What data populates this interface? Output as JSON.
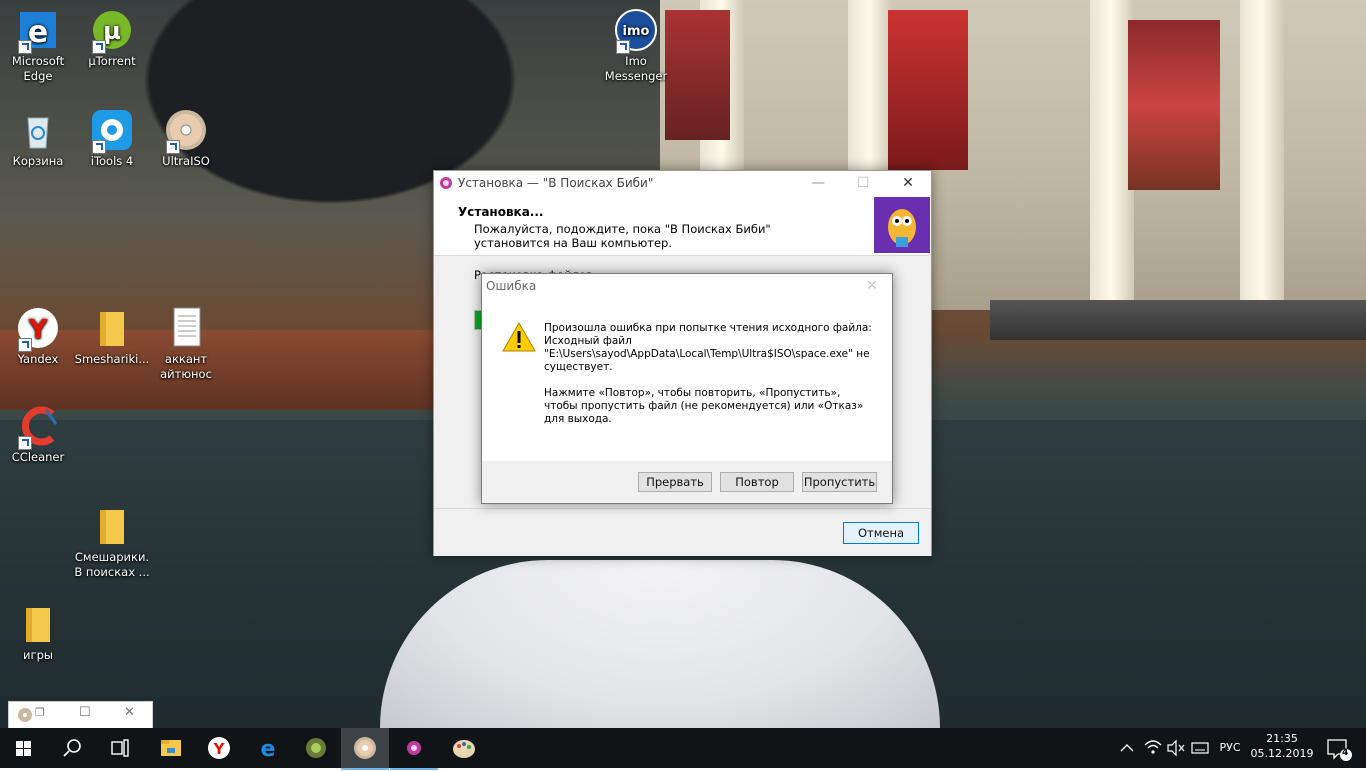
{
  "desktop": {
    "icons": [
      {
        "label": "Microsoft Edge",
        "icon": "edge-icon"
      },
      {
        "label": "µTorrent",
        "icon": "utorrent-icon"
      },
      {
        "label": "Imo Messenger",
        "icon": "imo-icon"
      },
      {
        "label": "Корзина",
        "icon": "recycle-bin-icon"
      },
      {
        "label": "iTools 4",
        "icon": "itools-icon"
      },
      {
        "label": "UltraISO",
        "icon": "ultraiso-icon"
      },
      {
        "label": "Yandex",
        "icon": "yandex-icon"
      },
      {
        "label": "Smeshariki...",
        "icon": "folder-icon"
      },
      {
        "label": "аккант айтюнос",
        "icon": "text-document-icon"
      },
      {
        "label": "CCleaner",
        "icon": "ccleaner-icon"
      },
      {
        "label": "Смешарики. В поисках ...",
        "icon": "folder-icon"
      },
      {
        "label": "игры",
        "icon": "folder-icon"
      }
    ],
    "bg_hint": "photo wallpaper: fountain in front of theatre building"
  },
  "installer": {
    "title": "Установка — \"В Поисках Биби\"",
    "header_title": "Установка...",
    "header_sub": "Пожалуйста, подождите, пока \"В Поисках Биби\" установится на Ваш компьютер.",
    "status_text": "Распаковка файлов...",
    "progress": 0.02,
    "cancel_label": "Отмена"
  },
  "error_dialog": {
    "title": "Ошибка",
    "line1": "Произошла ошибка при попытке чтения исходного файла:",
    "line2": "Исходный файл",
    "line3": "\"E:\\Users\\sayod\\AppData\\Local\\Temp\\Ultra$ISO\\space.exe\" не",
    "line4": "существует.",
    "hint1": "Нажмите «Повтор», чтобы повторить, «Пропустить»,",
    "hint2": "чтобы пропустить файл (не рекомендуется) или «Отказ»",
    "hint3": "для выхода.",
    "abort_label": "Прервать",
    "retry_label": "Повтор",
    "skip_label": "Пропустить"
  },
  "mini_window": {
    "icon": "ultraiso-icon"
  },
  "taskbar": {
    "apps": [
      "start-icon",
      "search-icon",
      "task-view-icon",
      "file-explorer-icon",
      "yandex-icon",
      "edge-icon",
      "itunes-icon",
      "ultraiso-icon",
      "installer-icon",
      "paint-icon"
    ],
    "lang": "РУС",
    "time": "21:35",
    "date": "05.12.2019",
    "notifications": "4"
  },
  "colors": {
    "accent": "#0078d7",
    "warning": "#ffcc00",
    "progress": "#06b025",
    "taskbar": "#101416"
  }
}
